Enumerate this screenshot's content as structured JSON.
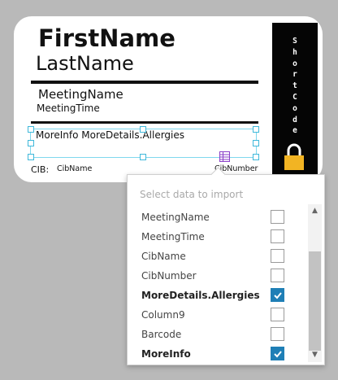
{
  "badge": {
    "first_name": "FirstName",
    "last_name": "LastName",
    "meeting_name": "MeetingName",
    "meeting_time": "MeetingTime",
    "more_info": "MoreInfo MoreDetails.Allergies",
    "cib_label": "CIB:",
    "cib_name": "CibName",
    "cib_number": "CibNumber",
    "short_code": "S\nh\no\nr\nt\nC\no\nd\ne"
  },
  "popup": {
    "title": "Select data to import",
    "items": [
      {
        "label": "MeetingName",
        "checked": false,
        "bold": false
      },
      {
        "label": "MeetingTime",
        "checked": false,
        "bold": false
      },
      {
        "label": "CibName",
        "checked": false,
        "bold": false
      },
      {
        "label": "CibNumber",
        "checked": false,
        "bold": false
      },
      {
        "label": "MoreDetails.Allergies",
        "checked": true,
        "bold": true
      },
      {
        "label": "Column9",
        "checked": false,
        "bold": false
      },
      {
        "label": "Barcode",
        "checked": false,
        "bold": false
      },
      {
        "label": "MoreInfo",
        "checked": true,
        "bold": true
      }
    ]
  },
  "colors": {
    "accent": "#1f7fb6",
    "selection": "#7fd8ee",
    "lock": "#f2b423",
    "table_icon": "#8a3ec8"
  }
}
